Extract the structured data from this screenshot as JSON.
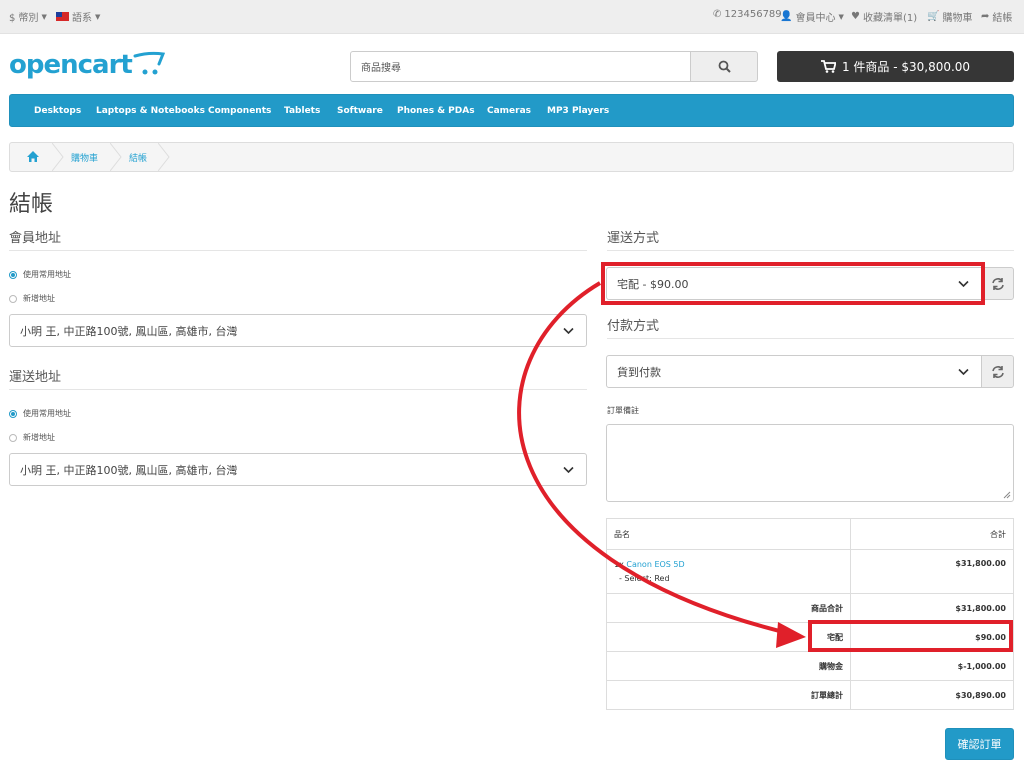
{
  "topbar": {
    "currency": "$ 幣別",
    "language": "語系",
    "phone": "123456789",
    "account": "會員中心",
    "wishlist": "收藏清單(1)",
    "cart": "購物車",
    "checkout": "結帳"
  },
  "header": {
    "logo": "opencart",
    "search_placeholder": "商品搜尋",
    "cart_summary": "1 件商品 - $30,800.00"
  },
  "nav": {
    "items": [
      "Desktops",
      "Laptops & Notebooks",
      "Components",
      "Tablets",
      "Software",
      "Phones & PDAs",
      "Cameras",
      "MP3 Players"
    ]
  },
  "breadcrumb": {
    "items": [
      "購物車",
      "結帳"
    ]
  },
  "page": {
    "title": "結帳"
  },
  "payment_address": {
    "title": "會員地址",
    "option_existing": "使用常用地址",
    "option_new": "新增地址",
    "selected": "小明 王, 中正路100號, 鳳山區, 高雄市, 台灣"
  },
  "shipping_address": {
    "title": "運送地址",
    "option_existing": "使用常用地址",
    "option_new": "新增地址",
    "selected": "小明 王, 中正路100號, 鳳山區, 高雄市, 台灣"
  },
  "shipping_method": {
    "title": "運送方式",
    "selected": "宅配 - $90.00"
  },
  "payment_method": {
    "title": "付款方式",
    "selected": "貨到付款"
  },
  "comment": {
    "label": "訂單備註"
  },
  "order": {
    "headers": [
      "品名",
      "合計"
    ],
    "product": {
      "qty": "1x",
      "name": "Canon EOS 5D",
      "option": "- Select: Red",
      "total": "$31,800.00"
    },
    "totals": [
      {
        "label": "商品合計",
        "value": "$31,800.00"
      },
      {
        "label": "宅配",
        "value": "$90.00"
      },
      {
        "label": "購物金",
        "value": "$-1,000.00"
      },
      {
        "label": "訂單總計",
        "value": "$30,890.00"
      }
    ]
  },
  "confirm_button": "確認訂單",
  "colors": {
    "brand": "#229ac8",
    "annotation": "#e0202a",
    "cart_button": "#363636"
  }
}
